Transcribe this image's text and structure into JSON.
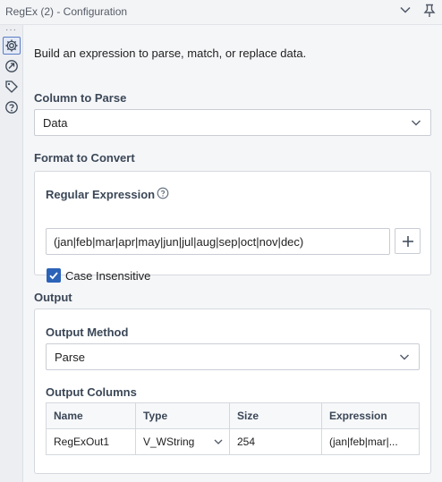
{
  "window": {
    "title": "RegEx (2) - Configuration"
  },
  "description": "Build an expression to parse, match, or replace data.",
  "column_to_parse": {
    "label": "Column to Parse",
    "value": "Data"
  },
  "format_to_convert": {
    "label": "Format to Convert",
    "regular_expression": {
      "label": "Regular Expression",
      "value": "(jan|feb|mar|apr|may|jun|jul|aug|sep|oct|nov|dec)"
    },
    "case_insensitive": {
      "label": "Case Insensitive",
      "checked": true
    }
  },
  "output": {
    "label": "Output",
    "method": {
      "label": "Output Method",
      "value": "Parse"
    },
    "columns": {
      "label": "Output Columns",
      "headers": [
        "Name",
        "Type",
        "Size",
        "Expression"
      ],
      "rows": [
        {
          "name": "RegExOut1",
          "type": "V_WString",
          "size": "254",
          "expression": "(jan|feb|mar|..."
        }
      ]
    }
  },
  "colors": {
    "accent": "#2b63b8",
    "label": "#3b4757"
  }
}
